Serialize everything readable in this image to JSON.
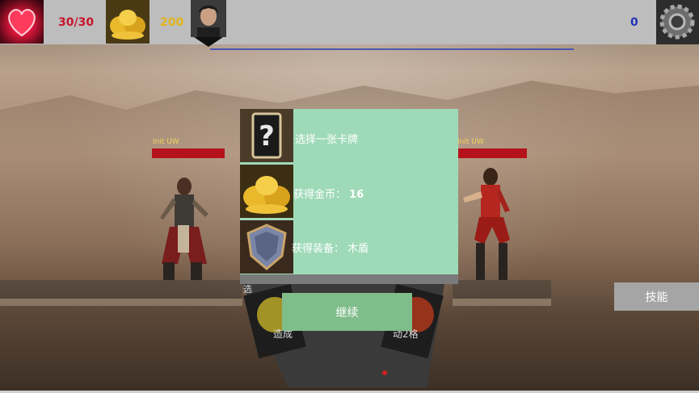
{
  "hud": {
    "hp": "30/30",
    "gold": "200",
    "score": "0",
    "icons": {
      "hp": "heart-icon",
      "gold": "gold-bags-icon",
      "settings": "gear-icon"
    }
  },
  "battle": {
    "player_name": "Init UW",
    "enemy_name": "Init UW"
  },
  "reward_panel": {
    "rows": [
      {
        "icon": "question-card-icon",
        "label": "选择一张卡牌",
        "value": ""
      },
      {
        "icon": "gold-bags-icon",
        "label": "获得金币：",
        "value": "16"
      },
      {
        "icon": "shield-icon",
        "label": "获得装备：",
        "value": "木盾"
      }
    ],
    "continue_label": "继续"
  },
  "cards": {
    "left_text": "造成",
    "right_text": "动2格",
    "corner_text": "选"
  },
  "skill_label": "技能",
  "colors": {
    "hp_text": "#c8142d",
    "gold_text": "#e2b51b",
    "score_text": "#1f33b8",
    "panel_bg": "#9fdab8",
    "continue_bg": "#7fbd8b"
  }
}
